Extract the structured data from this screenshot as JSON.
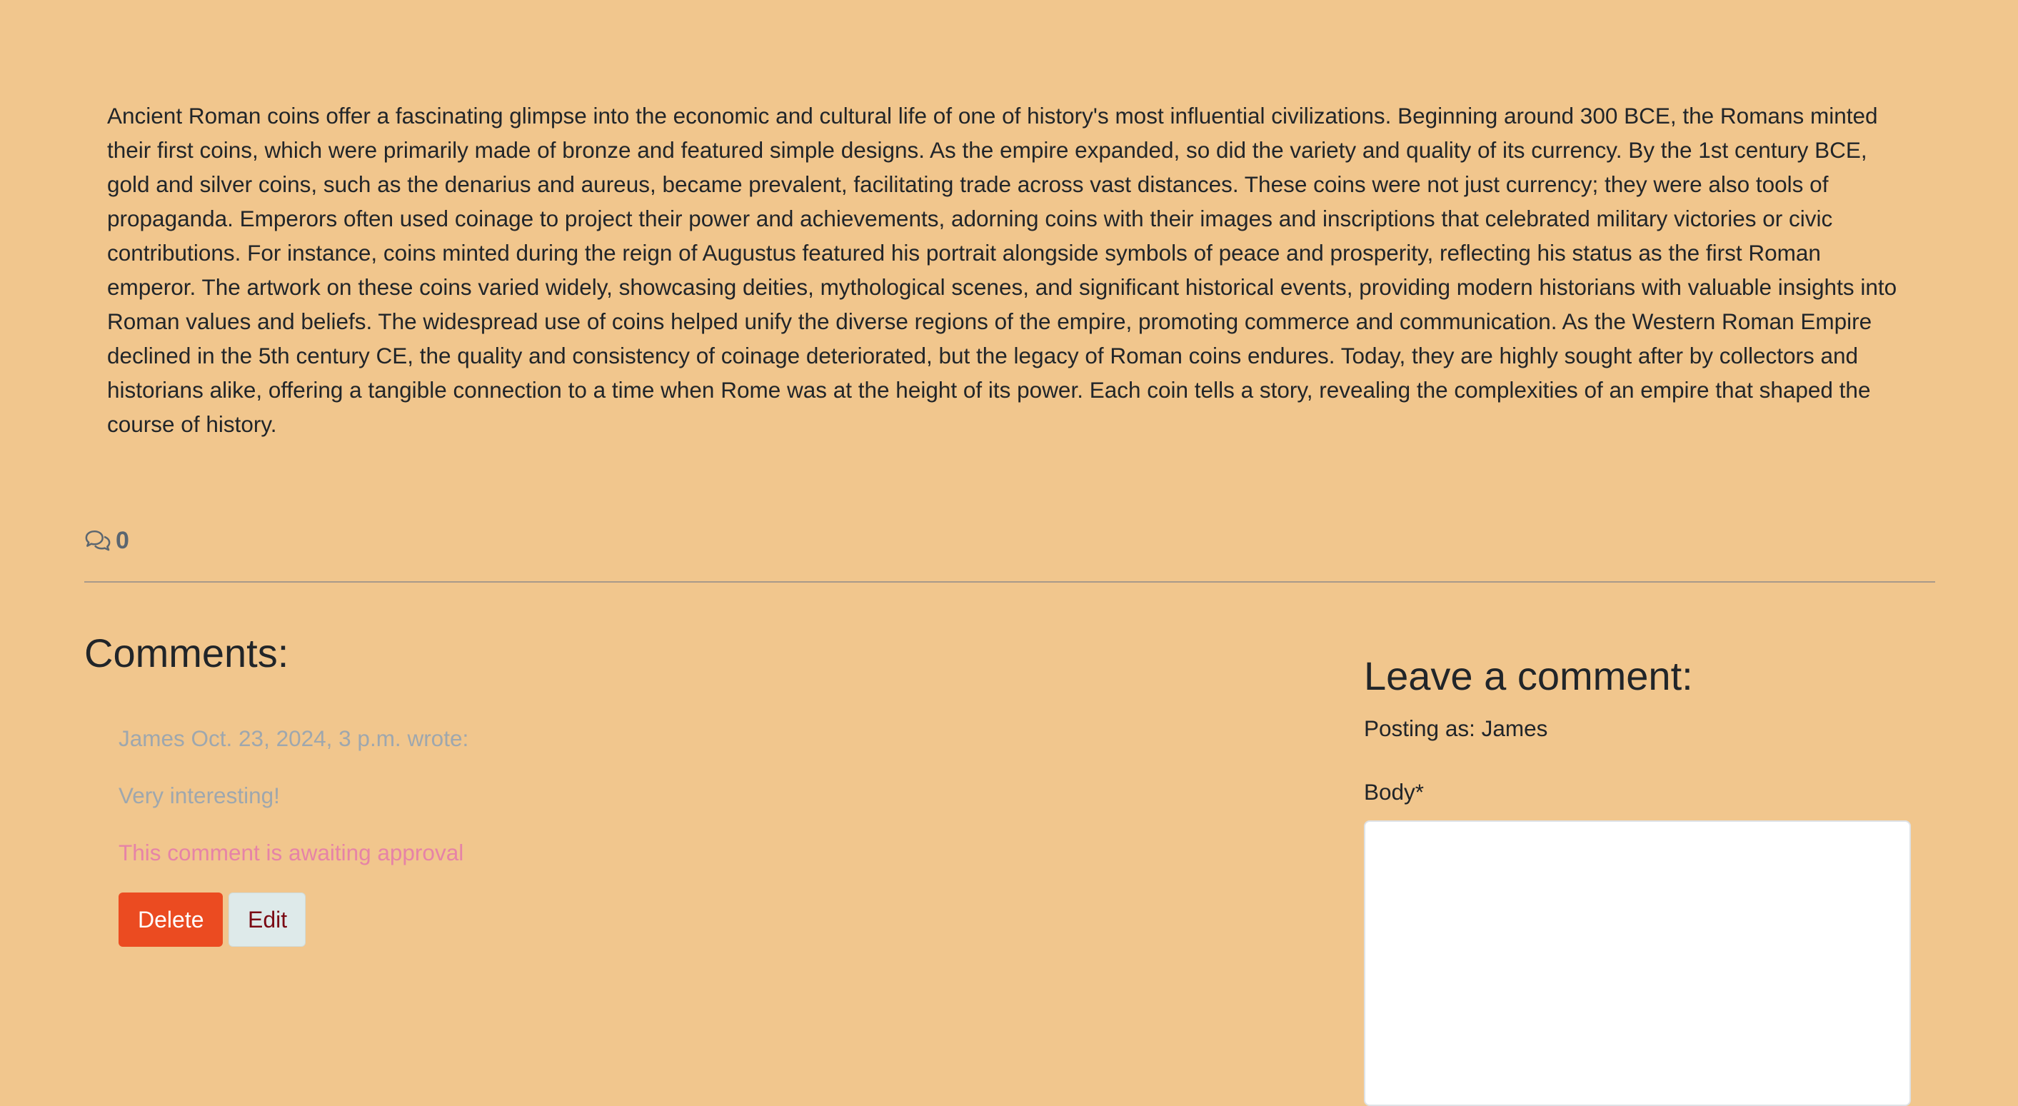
{
  "article": {
    "body": "Ancient Roman coins offer a fascinating glimpse into the economic and cultural life of one of history's most influential civilizations. Beginning around 300 BCE, the Romans minted their first coins, which were primarily made of bronze and featured simple designs. As the empire expanded, so did the variety and quality of its currency. By the 1st century BCE, gold and silver coins, such as the denarius and aureus, became prevalent, facilitating trade across vast distances. These coins were not just currency; they were also tools of propaganda. Emperors often used coinage to project their power and achievements, adorning coins with their images and inscriptions that celebrated military victories or civic contributions. For instance, coins minted during the reign of Augustus featured his portrait alongside symbols of peace and prosperity, reflecting his status as the first Roman emperor. The artwork on these coins varied widely, showcasing deities, mythological scenes, and significant historical events, providing modern historians with valuable insights into Roman values and beliefs. The widespread use of coins helped unify the diverse regions of the empire, promoting commerce and communication. As the Western Roman Empire declined in the 5th century CE, the quality and consistency of coinage deteriorated, but the legacy of Roman coins endures. Today, they are highly sought after by collectors and historians alike, offering a tangible connection to a time when Rome was at the height of its power. Each coin tells a story, revealing the complexities of an empire that shaped the course of history."
  },
  "stats": {
    "icon": "comments-icon",
    "comment_count": "0"
  },
  "comments_section": {
    "title": "Comments:",
    "comments": [
      {
        "meta": "James Oct. 23, 2024, 3 p.m. wrote:",
        "text": "Very interesting!",
        "status": "This comment is awaiting approval",
        "delete_label": "Delete",
        "edit_label": "Edit"
      }
    ]
  },
  "comment_form": {
    "title": "Leave a comment:",
    "posting_as": "Posting as: James",
    "body_label": "Body*",
    "body_value": ""
  },
  "colors": {
    "background": "#f1c68d",
    "delete_button": "#eb4b21",
    "edit_button": "#deeaea",
    "pending_status": "#e683a7",
    "muted_text": "#9ea7ae"
  }
}
